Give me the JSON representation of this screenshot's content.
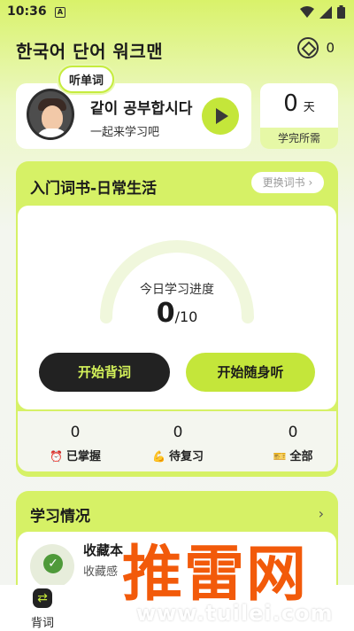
{
  "status_bar": {
    "time": "10:36",
    "notification_glyph": "A"
  },
  "header": {
    "title": "한국어 단어 워크맨",
    "coin_count": "0"
  },
  "listen_card": {
    "badge": "听单词",
    "title": "같이 공부합시다",
    "subtitle": "一起来学习吧"
  },
  "days_card": {
    "value": "0",
    "unit": "天",
    "label": "学完所需"
  },
  "book": {
    "title": "入门词书-日常生活",
    "change_label": "更换词书",
    "progress_label": "今日学习进度",
    "progress_current": "0",
    "progress_total": "/10",
    "start_label": "开始背词",
    "listen_label": "开始随身听",
    "stats": [
      {
        "value": "0",
        "label": "已掌握",
        "icon": "alarm-clock-icon"
      },
      {
        "value": "0",
        "label": "待复习",
        "icon": "muscle-icon"
      },
      {
        "value": "0",
        "label": "全部",
        "icon": "ticket-icon"
      }
    ]
  },
  "study": {
    "title": "学习情况",
    "fav_title": "收藏本",
    "fav_subtitle": "收藏感"
  },
  "bottom_nav": {
    "label": "背词",
    "icon": "swap-icon"
  },
  "watermark": {
    "text": "推雷网",
    "url": "www.tuilei.com"
  },
  "colors": {
    "accent": "#c4e63a",
    "panel": "#d6f166",
    "dark": "#222222",
    "watermark": "#f25a0a"
  }
}
